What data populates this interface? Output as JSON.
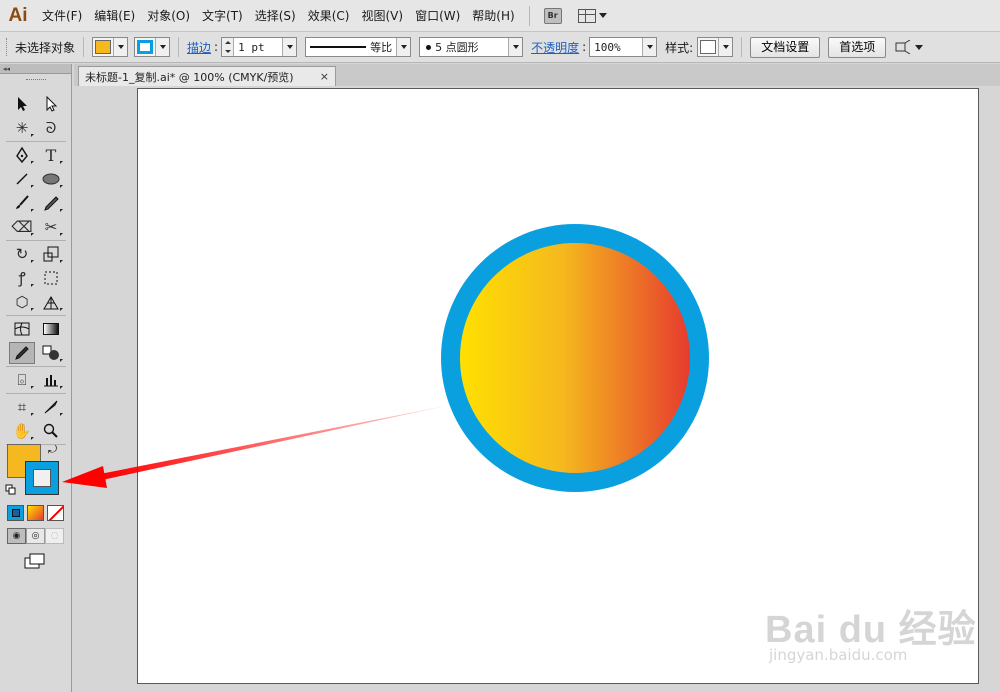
{
  "app": {
    "logo": "Ai"
  },
  "menu": [
    "文件(F)",
    "编辑(E)",
    "对象(O)",
    "文字(T)",
    "选择(S)",
    "效果(C)",
    "视图(V)",
    "窗口(W)",
    "帮助(H)"
  ],
  "menubar": {
    "bridge_label": "Br",
    "workspace_icon": "workspace-grid-icon"
  },
  "control": {
    "selection_status": "未选择对象",
    "fill_color": "#f5b81e",
    "stroke_color": "#0aa0e0",
    "stroke_label": "描边",
    "stroke_weight": "1 pt",
    "profile_label": "等比",
    "brush_label": "5 点圆形",
    "opacity_label": "不透明度",
    "opacity_value": "100%",
    "style_label": "样式:",
    "doc_setup_button": "文档设置",
    "prefs_button": "首选项"
  },
  "document": {
    "tab_title": "未标题-1_复制.ai* @ 100% (CMYK/预览)",
    "close_symbol": "×"
  },
  "artwork": {
    "circle_stroke_color": "#0aa0e0",
    "gradient_start": "#ffe000",
    "gradient_mid": "#f5b81e",
    "gradient_end": "#e63b2e",
    "arrow_color": "#ff0000"
  },
  "tools_panel": {
    "collapse_symbol": "◂◂",
    "fill_swatch": "#f5b81e",
    "stroke_swatch": "#0aa0e0"
  },
  "watermark": {
    "brand": "Bai du 经验",
    "url": "jingyan.baidu.com"
  }
}
